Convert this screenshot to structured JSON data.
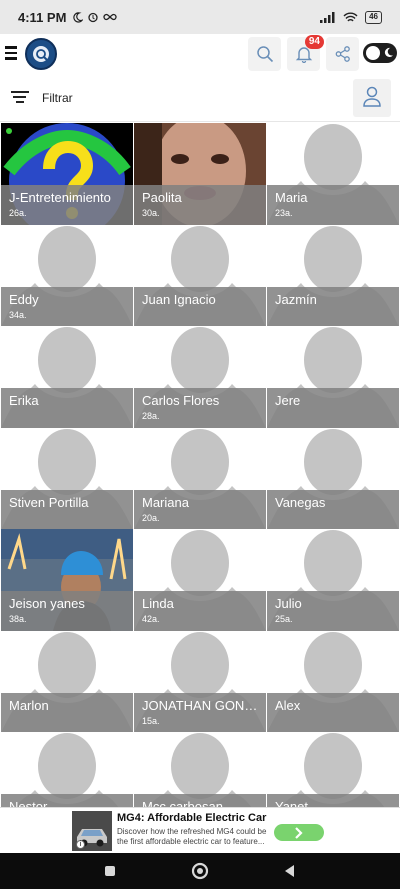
{
  "status_bar": {
    "time": "4:11 PM",
    "battery": "46"
  },
  "header": {
    "notification_count": "94"
  },
  "filter": {
    "label": "Filtrar"
  },
  "profiles": [
    {
      "name": "J-Entretenimiento",
      "age": "26a.",
      "photo": "question-mark-avatar",
      "online": true
    },
    {
      "name": "Paolita",
      "age": "30a.",
      "photo": "selfie-photo"
    },
    {
      "name": "Maria",
      "age": "23a."
    },
    {
      "name": "Eddy",
      "age": "34a."
    },
    {
      "name": "Juan Ignacio",
      "age": ""
    },
    {
      "name": "Jazmín",
      "age": ""
    },
    {
      "name": "Erika",
      "age": ""
    },
    {
      "name": "Carlos Flores",
      "age": "28a."
    },
    {
      "name": "Jere",
      "age": ""
    },
    {
      "name": "Stiven Portilla",
      "age": ""
    },
    {
      "name": "Mariana",
      "age": "20a."
    },
    {
      "name": "Vanegas",
      "age": ""
    },
    {
      "name": "Jeison yanes",
      "age": "38a.",
      "photo": "hardhat-photo"
    },
    {
      "name": "Linda",
      "age": "42a."
    },
    {
      "name": "Julio",
      "age": "25a."
    },
    {
      "name": "Marlon",
      "age": ""
    },
    {
      "name": "JONATHAN GONZ…",
      "age": "15a."
    },
    {
      "name": "Alex",
      "age": ""
    },
    {
      "name": "Nestor",
      "age": ""
    },
    {
      "name": "Mcc carbosan",
      "age": ""
    },
    {
      "name": "Yanet",
      "age": ""
    }
  ],
  "ad": {
    "title": "MG4: Affordable Electric Car",
    "description": "Discover how the refreshed MG4 could be the first affordable electric car to feature...",
    "info": "i"
  },
  "colors": {
    "label_overlay": "#808080",
    "badge": "#e53935",
    "cta": "#7ad36e"
  }
}
